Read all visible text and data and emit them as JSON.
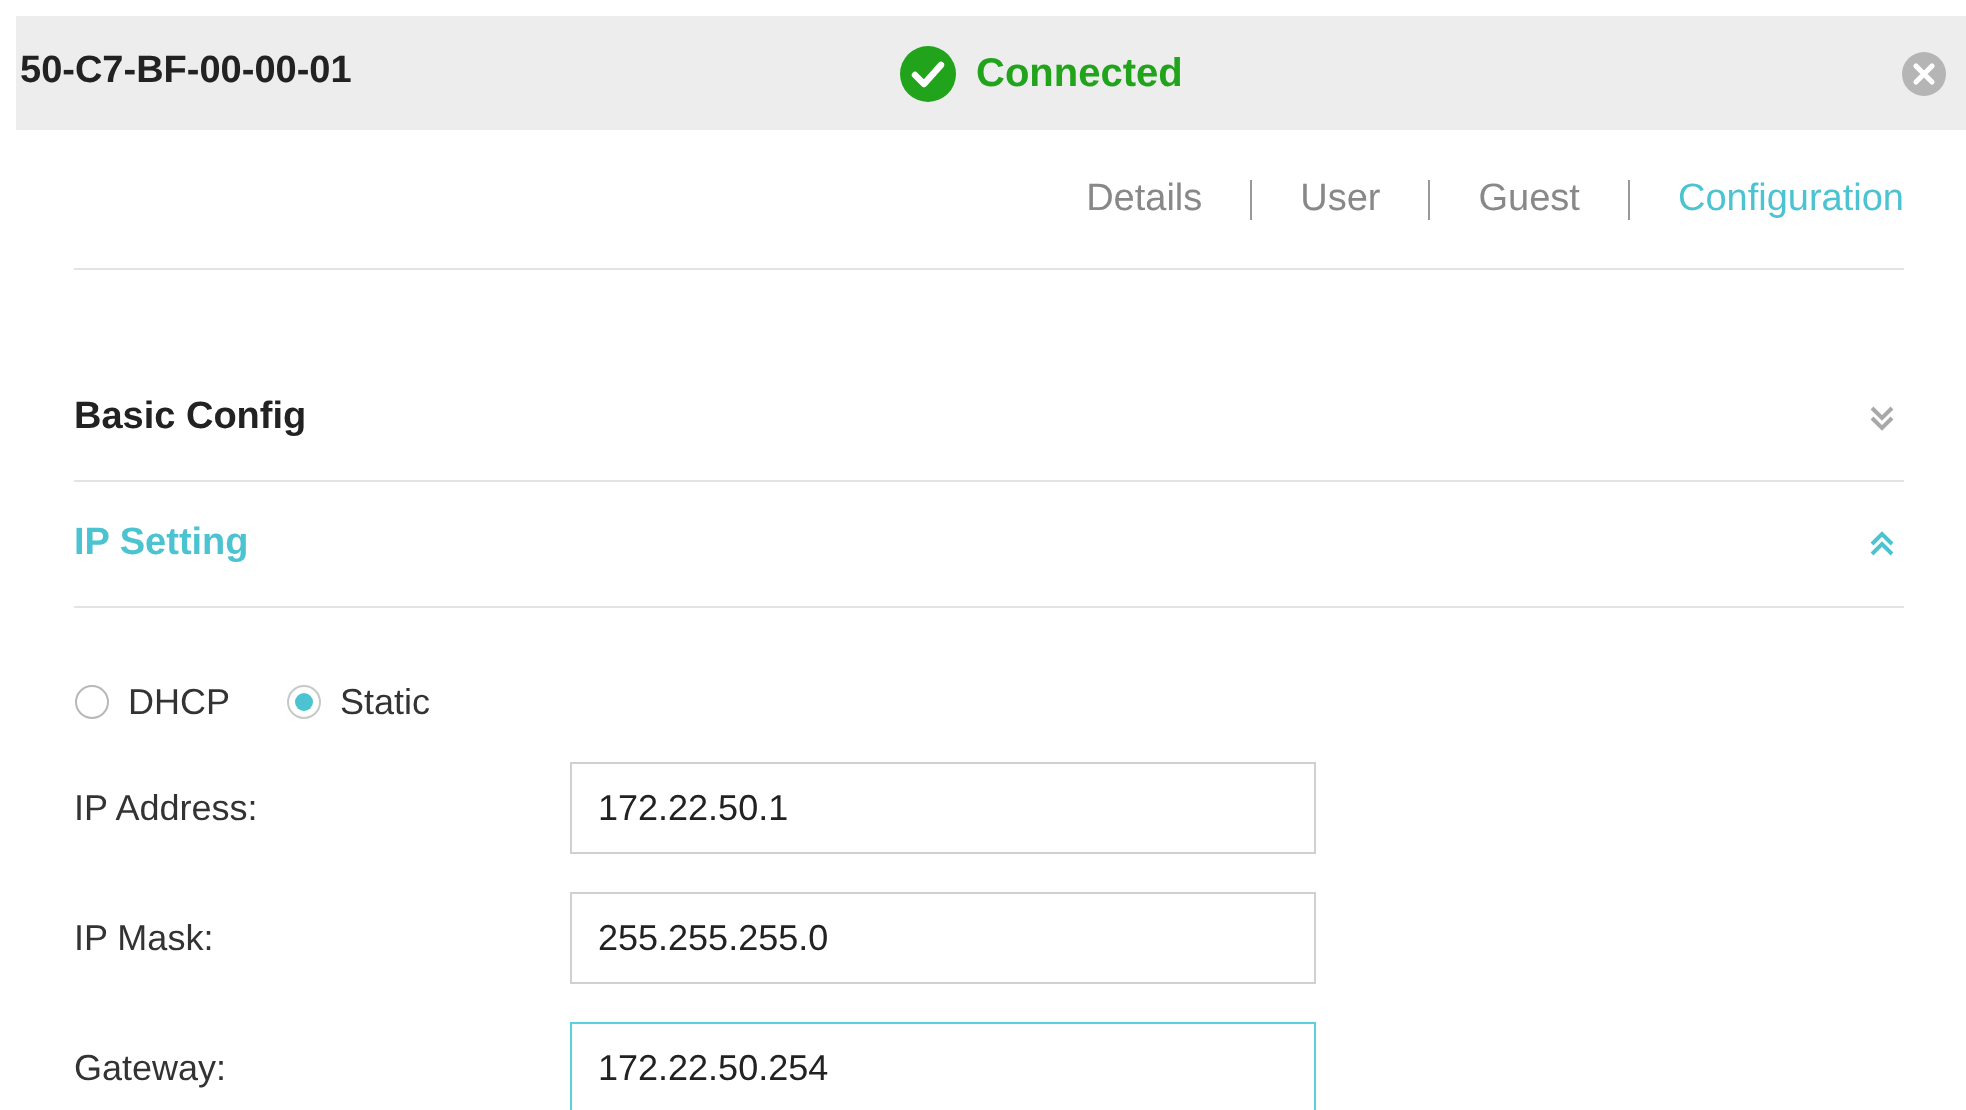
{
  "device_header": {
    "title": "50-C7-BF-00-00-01",
    "status": {
      "text": "Connected",
      "kind": "connected"
    }
  },
  "tabs": [
    {
      "label": "Details",
      "selected": false
    },
    {
      "label": "User",
      "selected": false
    },
    {
      "label": "Guest",
      "selected": false
    },
    {
      "label": "Configuration",
      "selected": true
    }
  ],
  "sections": [
    {
      "title": "Basic Config",
      "expanded": false
    },
    {
      "title": "IP Setting",
      "expanded": true
    }
  ],
  "ip_mode": [
    {
      "label": "DHCP",
      "selected": false
    },
    {
      "label": "Static",
      "selected": true
    }
  ],
  "fields": [
    {
      "label": "IP Address:",
      "value": "172.22.50.1",
      "focused": false
    },
    {
      "label": "IP Mask:",
      "value": "255.255.255.0",
      "focused": false
    },
    {
      "label": "Gateway:",
      "value": "172.22.50.254",
      "focused": true
    }
  ]
}
